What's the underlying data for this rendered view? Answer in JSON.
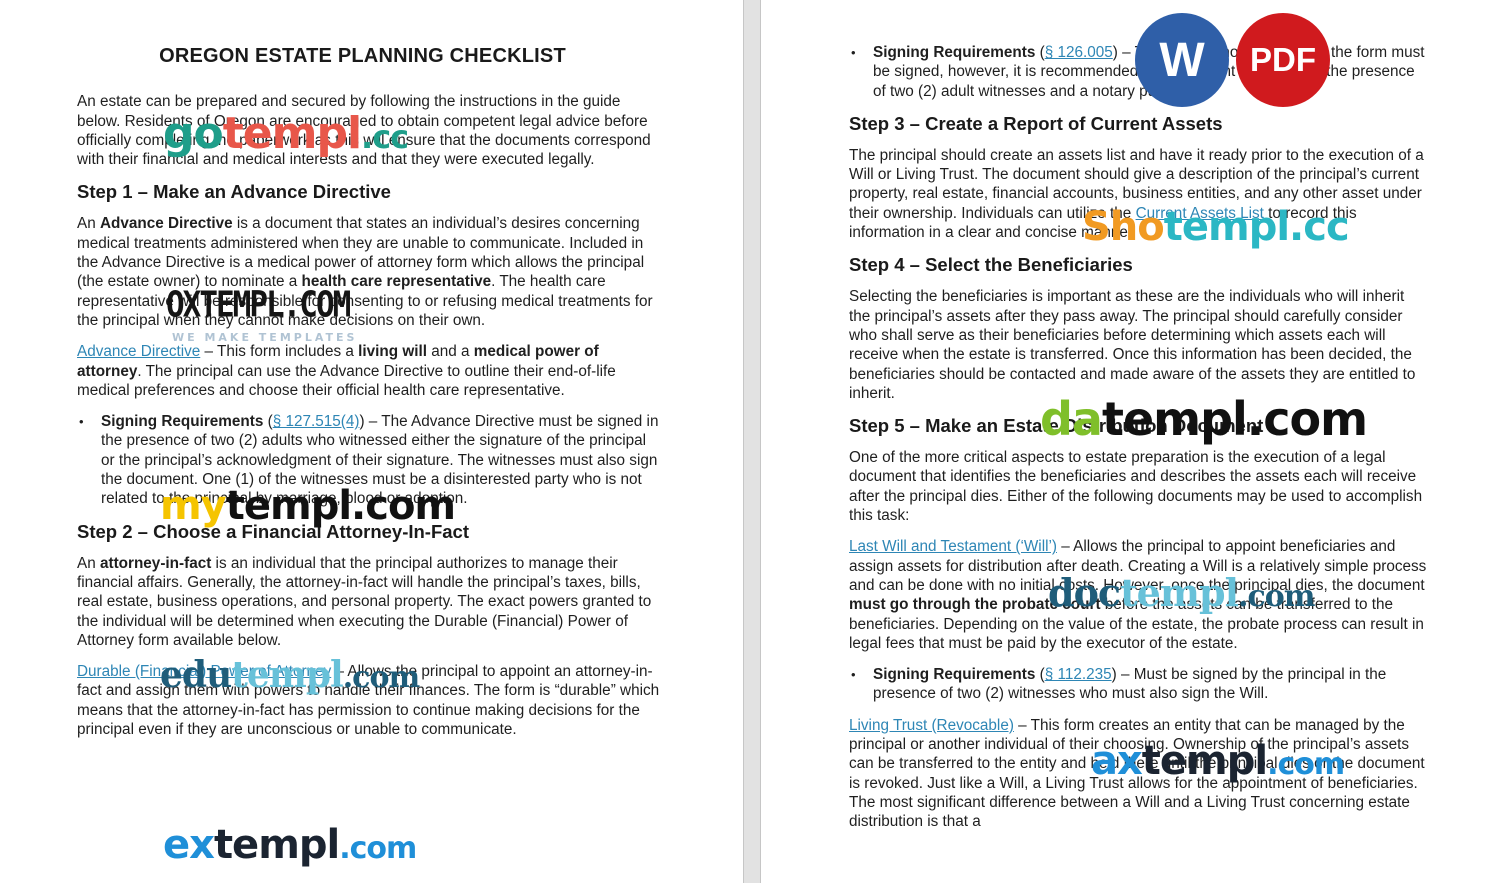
{
  "document": {
    "title": "OREGON ESTATE PLANNING CHECKLIST",
    "intro": "An estate can be prepared and secured by following the instructions in the guide below. Residents of Oregon are encouraged to obtain competent legal advice before officially completing the paperwork as this will ensure that the documents correspond with their financial and medical interests and that they were executed legally.",
    "step1": {
      "heading": "Step 1 – Make an Advance Directive",
      "p1_a": "An ",
      "p1_b": "Advance Directive",
      "p1_c": " is a document that states an individual’s desires concerning medical treatments administered when they are unable to communicate. Included in the Advance Directive is a medical power of attorney form which allows the principal (the estate owner) to nominate a ",
      "p1_d": "health care representative",
      "p1_e": ". The health care representative will be responsible for consenting to or refusing medical treatments for the principal when they cannot make decisions on their own.",
      "link": "Advance Directive",
      "p2_a": " – This form includes a ",
      "p2_b": "living will",
      "p2_c": " and a ",
      "p2_d": "medical power of attorney",
      "p2_e": ". The principal can use the Advance Directive to outline their end-of-life medical preferences and choose their official health care representative.",
      "bullet_label": "Signing Requirements",
      "bullet_open": " (",
      "bullet_link": "§ 127.515(4)",
      "bullet_text": ") – The Advance Directive must be signed in the presence of two (2) adults who witnessed either the signature of the principal or the principal’s acknowledgment of their signature. The witnesses must also sign the document. One (1) of the witnesses must be a disinterested party who is not related to the principal by marriage, blood or adoption."
    },
    "step2": {
      "heading": "Step 2 – Choose a Financial Attorney-In-Fact",
      "p1_a": "An ",
      "p1_b": "attorney-in-fact",
      "p1_c": " is an individual that the principal authorizes to manage their financial affairs. Generally, the attorney-in-fact will handle the principal’s taxes, bills, real estate, business operations, and personal property. The exact powers granted to the individual will be determined when executing the Durable (Financial) Power of Attorney form available below.",
      "link": "Durable (Financial) Power of Attorney",
      "p2": " – Allows the principal to appoint an attorney-in-fact and assign them with powers to handle their finances. The form is “durable” which means that the attorney-in-fact has permission to continue making decisions for the principal even if they are unconscious or unable to communicate.",
      "bullet_label": "Signing Requirements",
      "bullet_open": " (",
      "bullet_link": "§ 126.005",
      "bullet_text": ") – The laws do not specify how the form must be signed, however, it is recommended the document be signed in the presence of two (2) adult witnesses and a notary public."
    },
    "step3": {
      "heading": "Step 3 – Create a Report of Current Assets",
      "p1": "The principal should create an assets list and have it ready prior to the execution of a Will or Living Trust. The document should give a description of the principal’s current property, real estate, financial accounts, business entities, and any other asset under their ownership. Individuals can utilize the ",
      "link": "Current Assets List",
      "p2": " to record this information in a clear and concise manner."
    },
    "step4": {
      "heading": "Step 4 – Select the Beneficiaries",
      "p1": "Selecting the beneficiaries is important as these are the individuals who will inherit the principal’s assets after they pass away. The principal should carefully consider who shall serve as their beneficiaries before determining which assets each will receive when the estate is transferred. Once this information has been decided, the beneficiaries should be contacted and made aware of the assets they are entitled to inherit."
    },
    "step5": {
      "heading": "Step 5 – Make an Estate Distribution Document",
      "p1": "One of the more critical aspects to estate preparation is the execution of a legal document that identifies the beneficiaries and describes the assets each will receive after the principal dies. Either of the following documents may be used to accomplish this task:",
      "will_link": "Last Will and Testament (‘Will’)",
      "will_a": " – Allows the principal to appoint beneficiaries and assign assets for distribution after death. Creating a Will is a relatively simple process and can be done with no initial costs. However, once the principal dies, the document ",
      "will_b": "must go through the probate court",
      "will_c": " before the assets can be transferred to the beneficiaries. Depending on the value of the estate, the probate process can result in legal fees that must be paid by the executor of the estate.",
      "bullet_label": "Signing Requirements",
      "bullet_open": " (",
      "bullet_link": "§ 112.235",
      "bullet_text": ") – Must be signed by the principal in the presence of two (2) witnesses who must also sign the Will.",
      "trust_link": "Living Trust (Revocable)",
      "trust_text": " – This form creates an entity that can be managed by the principal or another individual of their choosing. Ownership of the principal’s assets can be transferred to the entity and held there until the principal dies or the document is revoked. Just like a Will, a Living Trust allows for the appointment of beneficiaries. The most significant difference between a Will and a Living Trust concerning estate distribution is that a"
    }
  },
  "badges": {
    "word_label": "W",
    "pdf_label": "PDF",
    "word_color": "#2f5fa8",
    "pdf_color": "#d01a1e"
  },
  "watermarks": {
    "gotempl": [
      "go",
      "templ",
      ".cc"
    ],
    "oxtempl": "OXTEMPL.COM",
    "oxtempl_sub": "WE MAKE TEMPLATES",
    "mytempl": [
      "my",
      "templ.com"
    ],
    "edutempl": [
      "edu",
      "templ",
      ".com"
    ],
    "extempl": [
      "ex",
      "templ",
      ".com"
    ],
    "shotempl": [
      "Sho",
      "templ.cc"
    ],
    "datempl": [
      "da",
      "templ.com"
    ],
    "doctempl": [
      "doc",
      "templ",
      ".com"
    ],
    "axtempl": [
      "ax",
      "templ",
      ".com"
    ]
  },
  "colors": {
    "link": "#2e86b5",
    "text": "#1f1f1f",
    "gutter": "#e2e2e2"
  },
  "bullet_glyph": "•"
}
